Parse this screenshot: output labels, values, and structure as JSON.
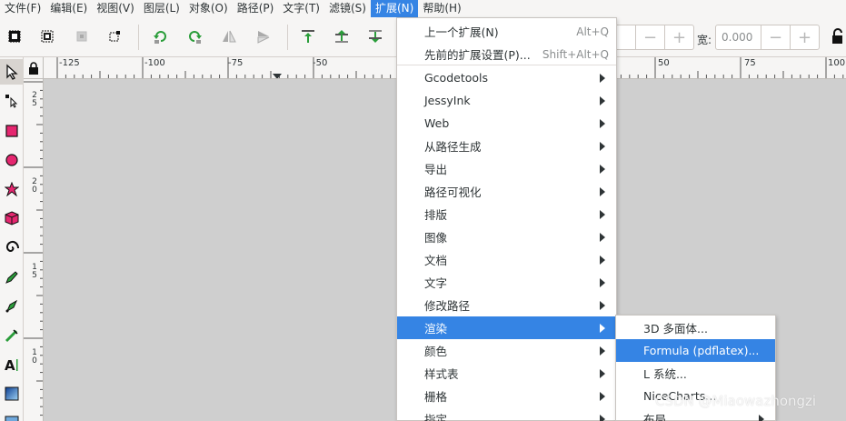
{
  "menubar": [
    {
      "label": "文件(F)"
    },
    {
      "label": "编辑(E)"
    },
    {
      "label": "视图(V)"
    },
    {
      "label": "图层(L)"
    },
    {
      "label": "对象(O)"
    },
    {
      "label": "路径(P)"
    },
    {
      "label": "文字(T)"
    },
    {
      "label": "滤镜(S)"
    },
    {
      "label": "扩展(N)",
      "active": true
    },
    {
      "label": "帮助(H)"
    }
  ],
  "toolbar": {
    "x_value": "",
    "width_label": "宽:",
    "width_value": "0.000",
    "minus": "−",
    "plus": "+"
  },
  "ruler": {
    "top_labels": [
      "-125",
      "-100",
      "-75",
      "-50",
      "50",
      "75",
      "100"
    ],
    "left_labels": [
      [
        "2",
        "5"
      ],
      [
        "2",
        "0"
      ],
      [
        "1",
        "5"
      ],
      [
        "1",
        "0"
      ]
    ]
  },
  "extensions_menu": {
    "items": [
      {
        "label": "上一个扩展(N)",
        "accel": "Alt+Q"
      },
      {
        "label": "先前的扩展设置(P)...",
        "accel": "Shift+Alt+Q"
      },
      {
        "label": "Gcodetools",
        "submenu": true
      },
      {
        "label": "JessyInk",
        "submenu": true
      },
      {
        "label": "Web",
        "submenu": true
      },
      {
        "label": "从路径生成",
        "submenu": true
      },
      {
        "label": "导出",
        "submenu": true
      },
      {
        "label": "路径可视化",
        "submenu": true
      },
      {
        "label": "排版",
        "submenu": true
      },
      {
        "label": "图像",
        "submenu": true
      },
      {
        "label": "文档",
        "submenu": true
      },
      {
        "label": "文字",
        "submenu": true
      },
      {
        "label": "修改路径",
        "submenu": true
      },
      {
        "label": "渲染",
        "submenu": true,
        "highlighted": true
      },
      {
        "label": "颜色",
        "submenu": true
      },
      {
        "label": "样式表",
        "submenu": true
      },
      {
        "label": "栅格",
        "submenu": true
      },
      {
        "label": "指定",
        "submenu": true
      }
    ]
  },
  "render_submenu": {
    "items": [
      {
        "label": "3D 多面体..."
      },
      {
        "label": "Formula (pdflatex)...",
        "highlighted": true
      },
      {
        "label": "L 系统..."
      },
      {
        "label": "NiceCharts..."
      },
      {
        "label": "布局",
        "submenu": true
      }
    ]
  },
  "watermark": "CSDN @Miaowazhongzi",
  "colors": {
    "accent": "#3584e4",
    "canvas": "#cfcfcf",
    "rect_tool": "#e5266f",
    "circle_tool": "#e5266f"
  }
}
